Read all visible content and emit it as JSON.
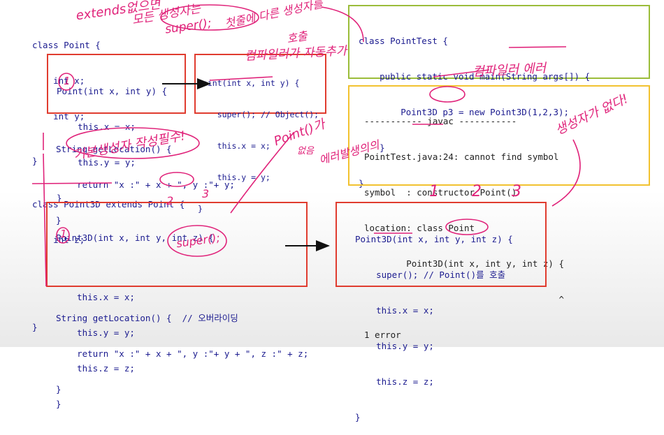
{
  "left_code": {
    "point_class": [
      "class Point {",
      "    int x;",
      "    int y;"
    ],
    "point_ctor": [
      "Point(int x, int y) {",
      "    this.x = x;",
      "    this.y = y;",
      "}"
    ],
    "point_ctor_super": [
      "Point(int x, int y) {",
      "    super(); // Object();",
      "    this.x = x;",
      "    this.y = y;",
      "}"
    ],
    "point_getloc": [
      "String getLocation() {",
      "    return \"x :\" + x + \", y :\"+ y;",
      "}",
      "}"
    ],
    "point3d_class": [
      "class Point3D extends Point {",
      "    int z;"
    ],
    "point3d_ctor": [
      "Point3D(int x, int y, int z) {",
      "",
      "    this.x = x;",
      "    this.y = y;",
      "    this.z = z;",
      "}"
    ],
    "point3d_getloc": [
      "String getLocation() {  // 오버라이딩",
      "    return \"x :\" + x + \", y :\"+ y + \", z :\" + z;",
      "}",
      "}"
    ]
  },
  "pointtest": [
    "class PointTest {",
    "    public static void main(String args[]) {",
    "        Point3D p3 = new Point3D(1,2,3);",
    "    }",
    "}"
  ],
  "javac": [
    "----------- javac -----------",
    "PointTest.java:24: cannot find symbol",
    "symbol  : constructor Point()",
    "location: class Point",
    "        Point3D(int x, int y, int z) {",
    "                                     ^",
    "1 error"
  ],
  "point3d_ctor_super": [
    "Point3D(int x, int y, int z) {",
    "    super(); // Point()를 호출",
    "    this.x = x;",
    "    this.y = y;",
    "    this.z = z;",
    "}"
  ],
  "annotations": {
    "top1": "extends없으면",
    "top2": "모든 생성자는",
    "top3": "super();",
    "top4": "첫줄에 다른 생성자를",
    "top5": "호출",
    "compiler_add": "컴파일러가 자동추가",
    "compile_error": "컴파일러 에러",
    "default_ctor": "기본생성자 작성필수!",
    "point_default": "Point()가",
    "no_point": "없음",
    "error_occurs": "에러발생의의",
    "ctor_needed": "생성자가 없다!",
    "super_hand": "super();",
    "circle1": "1",
    "n1": "1",
    "n2": "2",
    "n3": "3",
    "m1": "2",
    "m2": "3",
    "m3": "1"
  },
  "colors": {
    "red_box": "#e03c2f",
    "green_box": "#9bbd3a",
    "yellow_box": "#f2c230",
    "annotation": "#e0237a"
  }
}
